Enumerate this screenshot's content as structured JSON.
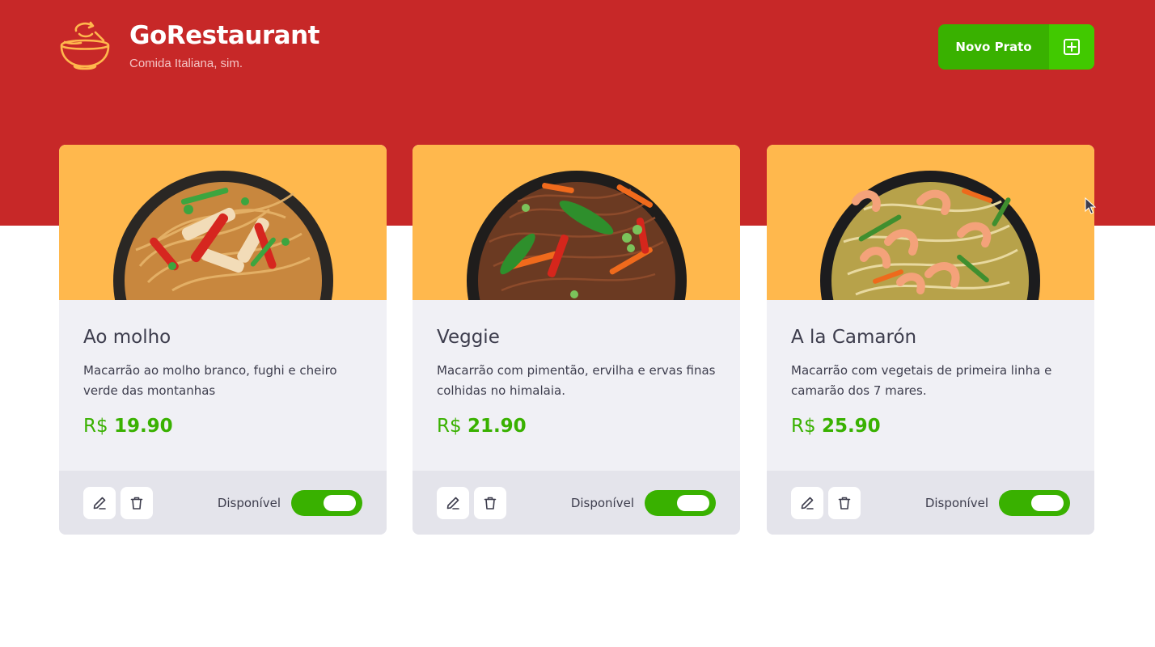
{
  "brand": {
    "title": "GoRestaurant",
    "subtitle": "Comida Italiana, sim.",
    "logo_icon": "bowl-icon"
  },
  "header": {
    "new_dish_label": "Novo Prato",
    "new_dish_icon": "plus-square-icon"
  },
  "colors": {
    "header_bg": "#c72828",
    "card_image_bg": "#ffb84d",
    "accent_green": "#39b100",
    "text_dark": "#3d3d4d"
  },
  "dishes": [
    {
      "name": "Ao molho",
      "description": "Macarrão ao molho branco, fughi e cheiro verde das montanhas",
      "currency": "R$",
      "price": "19.90",
      "available_label": "Disponível",
      "available": true
    },
    {
      "name": "Veggie",
      "description": "Macarrão com pimentão, ervilha e ervas finas colhidas no himalaia.",
      "currency": "R$",
      "price": "21.90",
      "available_label": "Disponível",
      "available": true
    },
    {
      "name": "A la Camarón",
      "description": "Macarrão com vegetais de primeira linha e camarão dos 7 mares.",
      "currency": "R$",
      "price": "25.90",
      "available_label": "Disponível",
      "available": true
    }
  ]
}
